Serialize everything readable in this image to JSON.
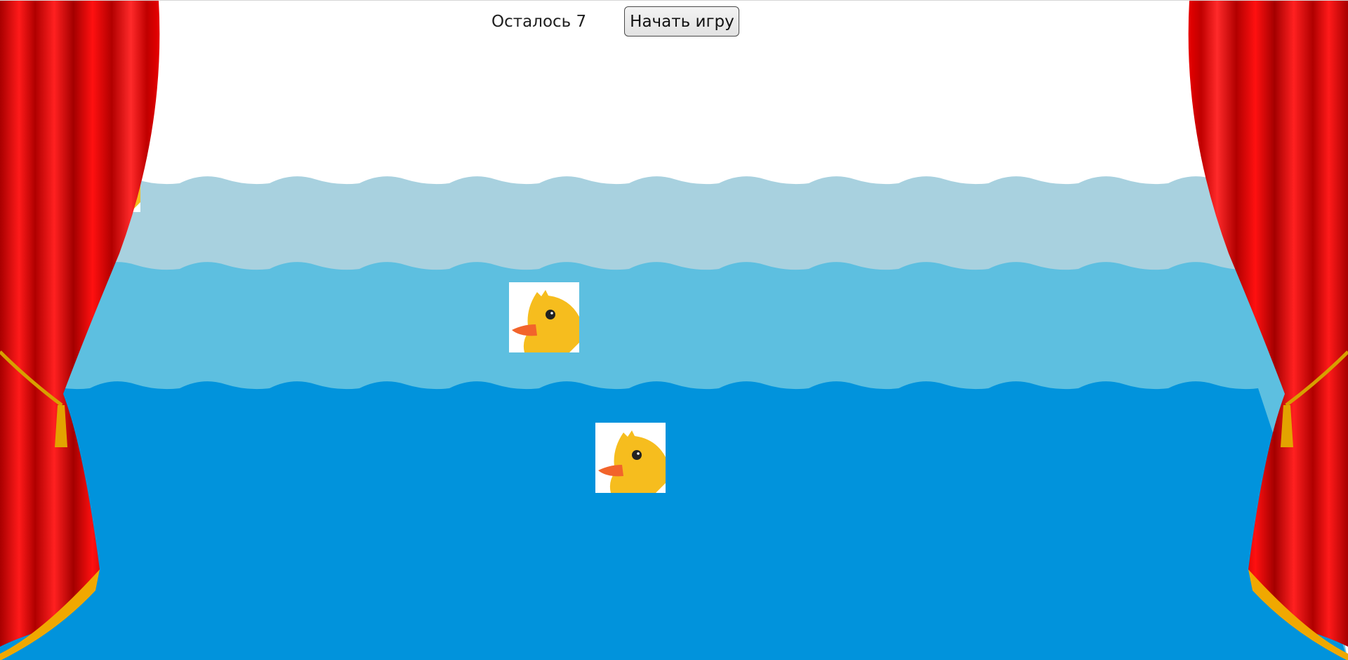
{
  "hud": {
    "counter_text": "Осталось 7",
    "start_button_label": "Начать игру"
  },
  "game": {
    "ducks_remaining": 7,
    "visible_ducks": 3
  },
  "colors": {
    "sky": "#ffffff",
    "water_back": "#a8d1df",
    "water_middle": "#5dbfe0",
    "water_front": "#0193dc",
    "curtain_red": "#e00000",
    "curtain_fringe": "#f0a800",
    "duck_yellow": "#f6bd1e",
    "duck_beak": "#f2642b"
  },
  "icons": {
    "duck": "duck-target-icon",
    "curtain_left": "stage-curtain-left",
    "curtain_right": "stage-curtain-right"
  }
}
